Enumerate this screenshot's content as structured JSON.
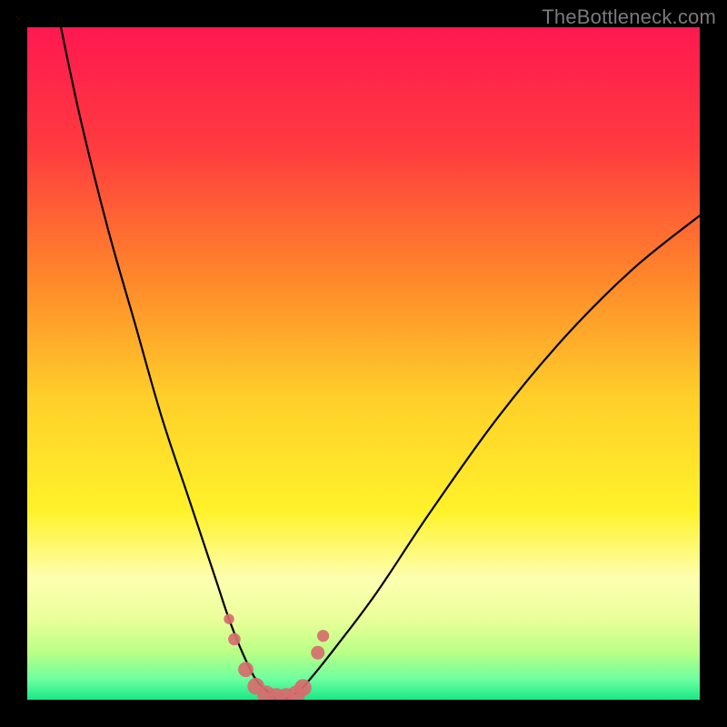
{
  "watermark": "TheBottleneck.com",
  "chart_data": {
    "type": "line",
    "title": "",
    "xlabel": "",
    "ylabel": "",
    "xlim": [
      0,
      100
    ],
    "ylim": [
      0,
      100
    ],
    "grid": false,
    "series": [
      {
        "name": "bottleneck-curve",
        "x": [
          5,
          8,
          12,
          16,
          20,
          24,
          28,
          30,
          32,
          34,
          36,
          37,
          38,
          40,
          42,
          46,
          52,
          60,
          70,
          80,
          90,
          100
        ],
        "y": [
          100,
          86,
          70,
          56,
          42,
          30,
          18,
          12,
          7,
          3,
          1,
          0,
          0,
          1,
          3,
          8,
          16,
          28,
          42,
          54,
          64,
          72
        ]
      }
    ],
    "markers": {
      "name": "highlight-points",
      "x": [
        30,
        30.8,
        32.5,
        34,
        35.5,
        37,
        38.5,
        40,
        41,
        43.2,
        44
      ],
      "y": [
        12,
        9,
        4.5,
        2,
        0.8,
        0.4,
        0.4,
        0.8,
        1.8,
        7,
        9.5
      ],
      "color": "#d66c6e",
      "size_min": 5,
      "size_max": 10
    },
    "gradient_stops": [
      {
        "offset": 0.0,
        "color": "#ff1850"
      },
      {
        "offset": 0.18,
        "color": "#ff3b3f"
      },
      {
        "offset": 0.38,
        "color": "#ff8a2a"
      },
      {
        "offset": 0.55,
        "color": "#ffcf2a"
      },
      {
        "offset": 0.72,
        "color": "#fff22a"
      },
      {
        "offset": 0.82,
        "color": "#fdffb0"
      },
      {
        "offset": 0.88,
        "color": "#eaff9a"
      },
      {
        "offset": 0.93,
        "color": "#b9ff86"
      },
      {
        "offset": 0.97,
        "color": "#6cffa0"
      },
      {
        "offset": 1.0,
        "color": "#18e886"
      }
    ]
  }
}
